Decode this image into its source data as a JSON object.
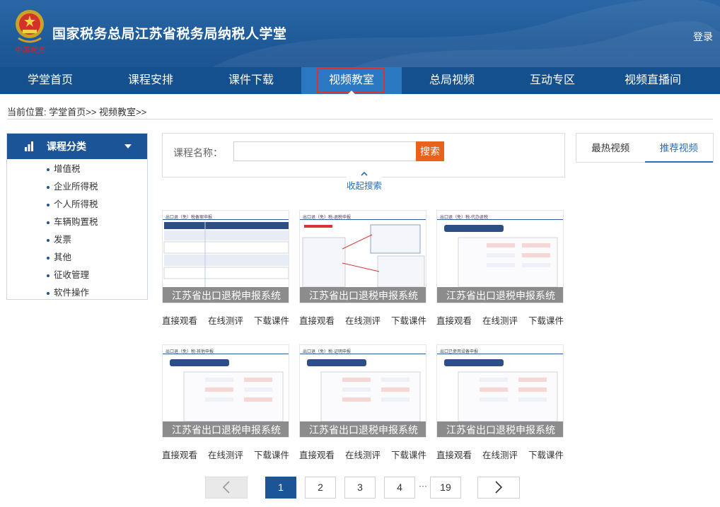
{
  "header": {
    "title": "国家税务总局江苏省税务局纳税人学堂",
    "emblem_text": "中国税务",
    "login_label": "登录",
    "colors": {
      "header_bg": "#1f5a99",
      "nav_bg": "#14508e",
      "nav_active": "#2a77c2",
      "highlight": "#e0322d"
    }
  },
  "nav": {
    "items": [
      {
        "label": "学堂首页"
      },
      {
        "label": "课程安排"
      },
      {
        "label": "课件下载"
      },
      {
        "label": "视频教室"
      },
      {
        "label": "总局视频"
      },
      {
        "label": "互动专区"
      },
      {
        "label": "视频直播间"
      }
    ],
    "active_index": 3
  },
  "breadcrumb": {
    "text": "当前位置: 学堂首页>> 视频教室>>"
  },
  "sidebar": {
    "title": "课程分类",
    "items": [
      {
        "label": "增值税"
      },
      {
        "label": "企业所得税"
      },
      {
        "label": "个人所得税"
      },
      {
        "label": "车辆购置税"
      },
      {
        "label": "发票"
      },
      {
        "label": "其他"
      },
      {
        "label": "征收管理"
      },
      {
        "label": "软件操作"
      }
    ]
  },
  "search": {
    "label": "课程名称：",
    "value": "",
    "placeholder": "",
    "button_label": "搜索",
    "collapse_label": "收起搜索"
  },
  "tabs": {
    "items": [
      {
        "label": "最热视频"
      },
      {
        "label": "推荐视频"
      }
    ],
    "active_index": 1
  },
  "videos": [
    {
      "caption": "江苏省出口退税申报系统",
      "doc_header": "出口退（免）税备案申报",
      "actions": [
        "直接观看",
        "在线测评",
        "下载课件"
      ]
    },
    {
      "caption": "江苏省出口退税申报系统",
      "doc_header": "出口退（免）税-退税申报",
      "actions": [
        "直接观看",
        "在线测评",
        "下载课件"
      ]
    },
    {
      "caption": "江苏省出口退税申报系统",
      "doc_header": "出口退（免）税-代办退税",
      "actions": [
        "直接观看",
        "在线测评",
        "下载课件"
      ]
    },
    {
      "caption": "江苏省出口退税申报系统",
      "doc_header": "出口退（免）税-其他申报",
      "actions": [
        "直接观看",
        "在线测评",
        "下载课件"
      ]
    },
    {
      "caption": "江苏省出口退税申报系统",
      "doc_header": "出口退（免）税-证明申报",
      "actions": [
        "直接观看",
        "在线测评",
        "下载课件"
      ]
    },
    {
      "caption": "江苏省出口退税申报系统",
      "doc_header": "出口已使用设备申报",
      "actions": [
        "直接观看",
        "在线测评",
        "下载课件"
      ]
    }
  ],
  "pagination": {
    "pages": [
      "1",
      "2",
      "3",
      "4",
      "19"
    ],
    "current": "1",
    "ellipsis": "···",
    "prev_icon": "chevron-left-icon",
    "next_icon": "chevron-right-icon"
  }
}
